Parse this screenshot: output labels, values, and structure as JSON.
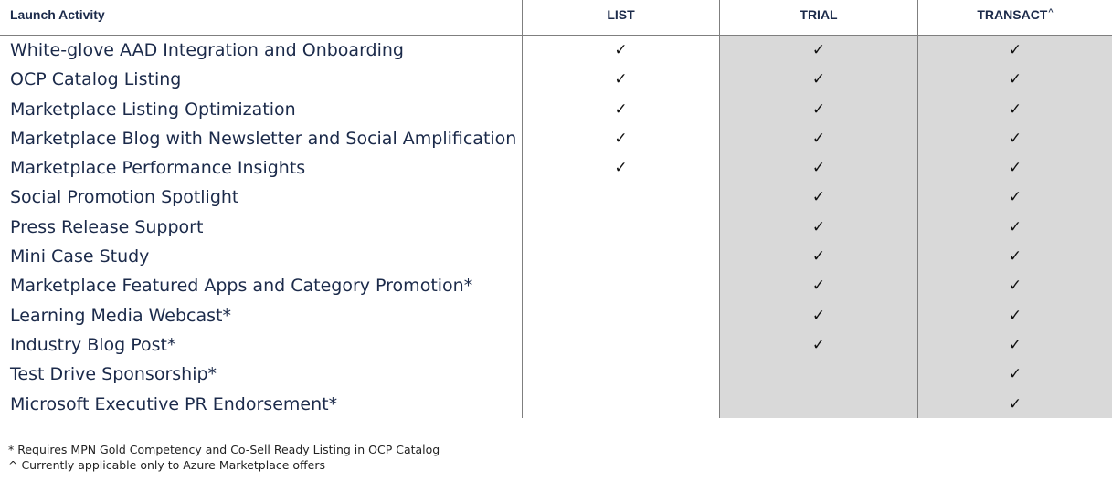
{
  "header": {
    "activity": "Launch Activity",
    "list": "LIST",
    "trial": "TRIAL",
    "transact": "TRANSACT",
    "transact_marker": "^"
  },
  "check_glyph": "✓",
  "rows": [
    {
      "label": "White-glove AAD Integration and Onboarding",
      "list": true,
      "trial": true,
      "transact": true
    },
    {
      "label": "OCP Catalog Listing",
      "list": true,
      "trial": true,
      "transact": true
    },
    {
      "label": "Marketplace Listing Optimization",
      "list": true,
      "trial": true,
      "transact": true
    },
    {
      "label": "Marketplace Blog with Newsletter and Social Amplification",
      "list": true,
      "trial": true,
      "transact": true
    },
    {
      "label": "Marketplace Performance Insights",
      "list": true,
      "trial": true,
      "transact": true
    },
    {
      "label": "Social Promotion Spotlight",
      "list": false,
      "trial": true,
      "transact": true
    },
    {
      "label": "Press Release Support",
      "list": false,
      "trial": true,
      "transact": true
    },
    {
      "label": "Mini Case Study",
      "list": false,
      "trial": true,
      "transact": true
    },
    {
      "label": "Marketplace Featured Apps and Category Promotion*",
      "list": false,
      "trial": true,
      "transact": true
    },
    {
      "label": "Learning Media Webcast*",
      "list": false,
      "trial": true,
      "transact": true
    },
    {
      "label": "Industry Blog Post*",
      "list": false,
      "trial": true,
      "transact": true
    },
    {
      "label": "Test Drive Sponsorship*",
      "list": false,
      "trial": false,
      "transact": true
    },
    {
      "label": "Microsoft Executive PR Endorsement*",
      "list": false,
      "trial": false,
      "transact": true
    }
  ],
  "footnotes": [
    "* Requires MPN Gold Competency and Co-Sell Ready Listing in OCP Catalog",
    "^ Currently applicable only to Azure Marketplace offers"
  ],
  "colors": {
    "text": "#1b2a4a",
    "shade": "#d9d9d9",
    "rule": "#7f7f7f"
  }
}
